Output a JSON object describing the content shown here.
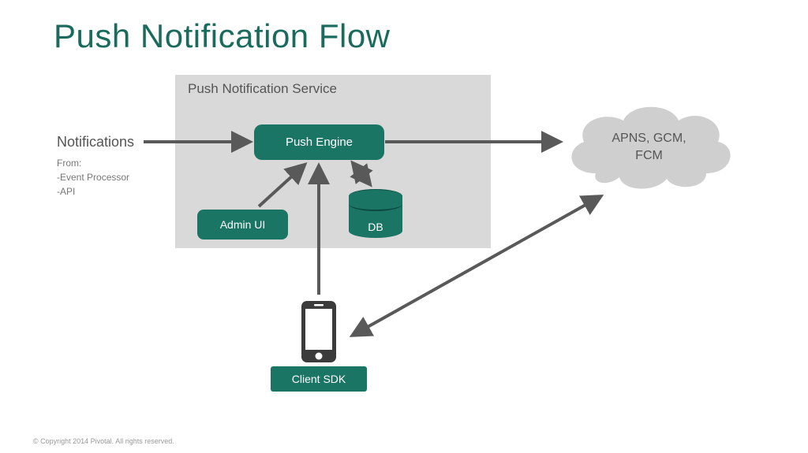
{
  "title": "Push Notification Flow",
  "service": {
    "container_label": "Push Notification Service",
    "push_engine_label": "Push Engine",
    "admin_ui_label": "Admin UI",
    "db_label": "DB"
  },
  "notifications": {
    "heading": "Notifications",
    "from_label": "From:",
    "source1": "-Event Processor",
    "source2": "-API"
  },
  "cloud": {
    "label_line1": "APNS, GCM,",
    "label_line2": "FCM"
  },
  "client_sdk_label": "Client SDK",
  "copyright": "© Copyright 2014 Pivotal. All rights reserved.",
  "colors": {
    "teal": "#1a7565",
    "title": "#145f52",
    "gray_box": "#d9d9d9",
    "arrow": "#595959",
    "cloud": "#cfcfcf"
  }
}
